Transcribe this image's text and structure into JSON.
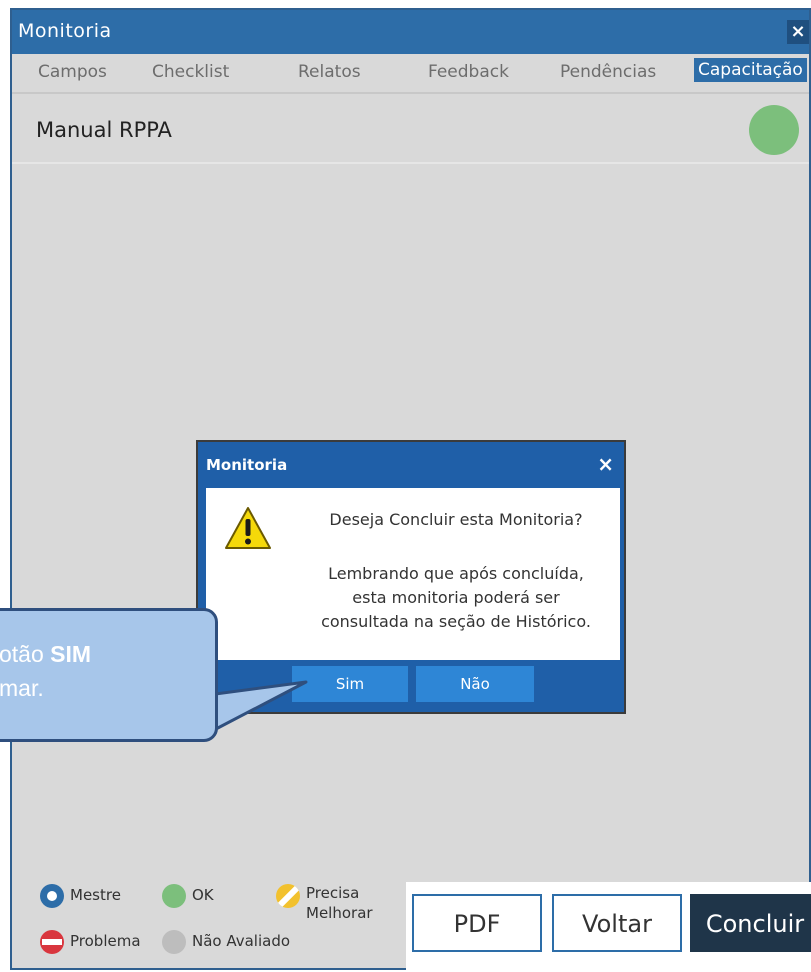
{
  "window": {
    "title": "Monitoria",
    "close_icon": "×"
  },
  "tabs": [
    "Campos",
    "Checklist",
    "Relatos",
    "Feedback",
    "Pendências",
    "Capacitação"
  ],
  "active_tab": "Capacitação",
  "list": {
    "item_label": "Manual RPPA",
    "item_status_color": "#7cbf7c"
  },
  "legend": {
    "mestre": "Mestre",
    "ok": "OK",
    "precisa_line1": "Precisa",
    "precisa_line2": "Melhorar",
    "problema": "Problema",
    "nao_avaliado": "Não Avaliado"
  },
  "buttons": {
    "pdf": "PDF",
    "voltar": "Voltar",
    "concluir": "Concluir"
  },
  "modal": {
    "title": "Monitoria",
    "close_icon": "×",
    "question": "Deseja Concluir esta Monitoria?",
    "line1": "Lembrando que após concluída,",
    "line2": "esta monitoria poderá ser",
    "line3": "consultada na seção de Histórico.",
    "yes_label": "Sim",
    "no_label": "Não"
  },
  "callout": {
    "line1_text": "otão ",
    "line1_bold": "SIM",
    "line2_text": "mar."
  },
  "colors": {
    "accent": "#2d6da8",
    "dark_button": "#1f3549",
    "modal_button": "#2e86d6",
    "callout_fill": "#a7c6ea"
  }
}
